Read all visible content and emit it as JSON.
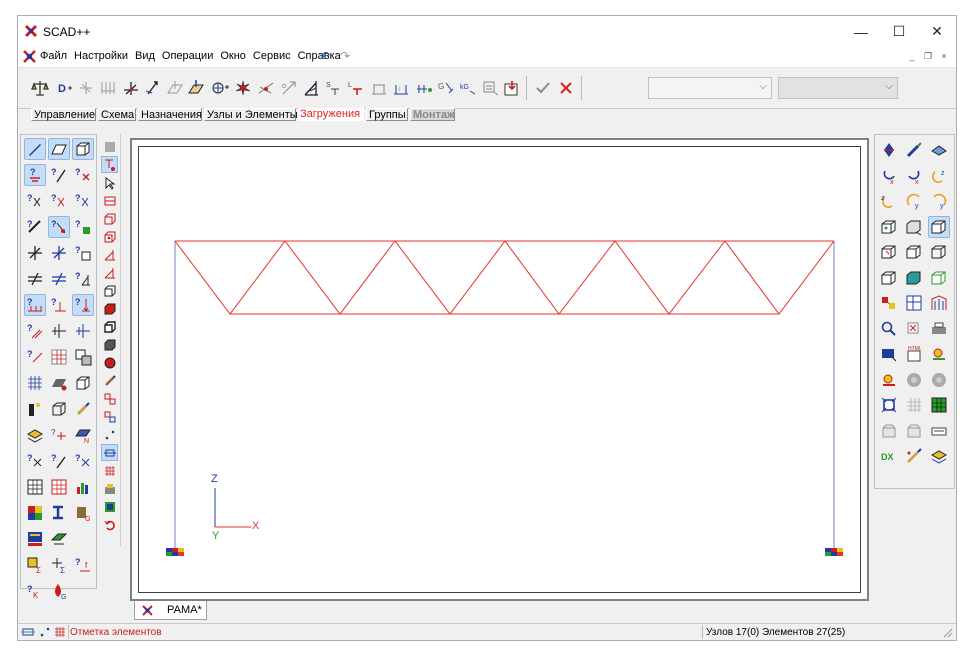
{
  "window": {
    "title": "SCAD++",
    "minimize": "—",
    "maximize": "☐",
    "close": "✕"
  },
  "menu": {
    "items": [
      "Файл",
      "Настройки",
      "Вид",
      "Операции",
      "Окно",
      "Сервис",
      "Справка"
    ]
  },
  "mdi": {
    "minimize": "_",
    "restore": "❐",
    "close": "×"
  },
  "tabs": [
    {
      "label": "Управление"
    },
    {
      "label": "Схема"
    },
    {
      "label": "Назначения"
    },
    {
      "label": "Узлы и Элементы"
    },
    {
      "label": "Загружения"
    },
    {
      "label": "Группы"
    },
    {
      "label": "Монтаж"
    }
  ],
  "active_tab": "Загружения",
  "axes": {
    "z": "Z",
    "y": "Y",
    "x": "X"
  },
  "document_tab": {
    "label": "РАМА*"
  },
  "status": {
    "mode": "Отметка элементов",
    "counts": "Узлов 17(0) Элементов 27(25)"
  },
  "colors": {
    "frame_lines": "#e8322c",
    "columns": "#6e7cd0",
    "accent_tab": "#e81e1e"
  }
}
